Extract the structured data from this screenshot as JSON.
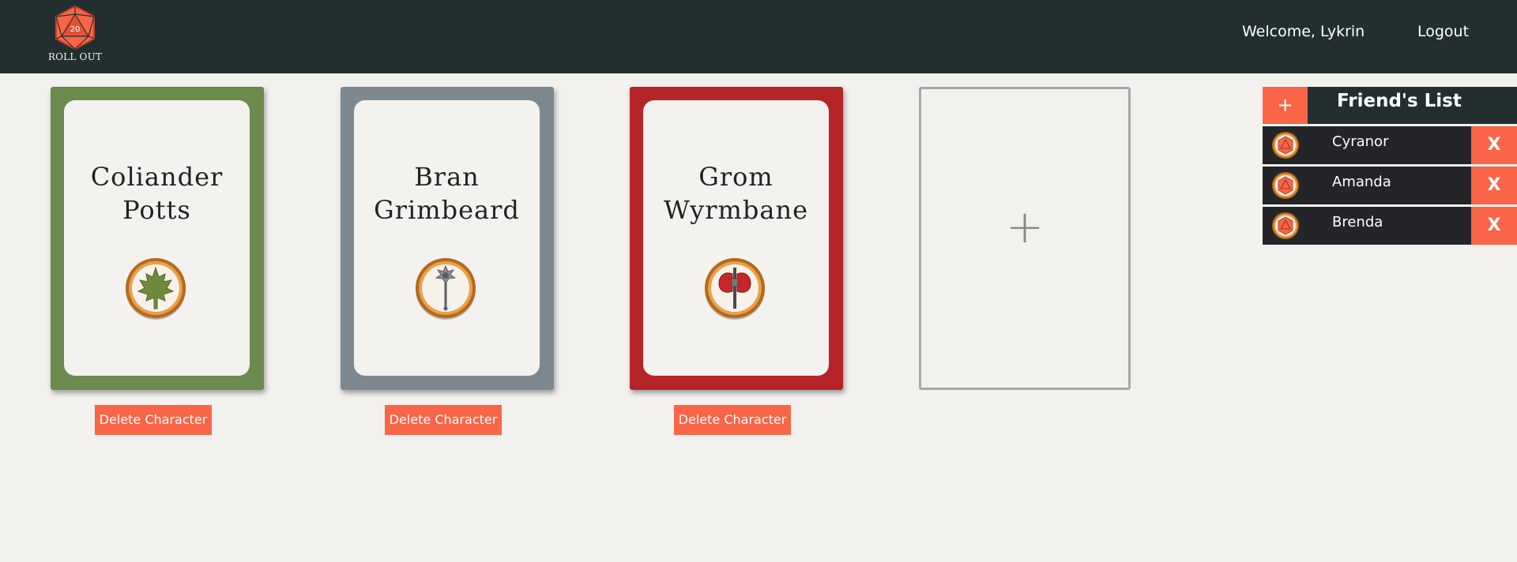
{
  "header": {
    "logo_text": "ROLL OUT",
    "logo_die_number": "20",
    "welcome": "Welcome, Lykrin",
    "logout": "Logout"
  },
  "characters": [
    {
      "name_line1": "Coliander",
      "name_line2": "Potts",
      "color": "#6a8a4e",
      "badge": "maple-leaf-icon",
      "delete_label": "Delete Character"
    },
    {
      "name_line1": "Bran",
      "name_line2": "Grimbeard",
      "color": "#7d8991",
      "badge": "mace-icon",
      "delete_label": "Delete Character"
    },
    {
      "name_line1": "Grom",
      "name_line2": "Wyrmbane",
      "color": "#b52427",
      "badge": "battle-axe-icon",
      "delete_label": "Delete Character"
    }
  ],
  "add_card": {
    "symbol": "+"
  },
  "friends": {
    "add_symbol": "+",
    "title": "Friend's List",
    "remove_symbol": "X",
    "items": [
      {
        "name": "Cyranor"
      },
      {
        "name": "Amanda"
      },
      {
        "name": "Brenda"
      }
    ]
  },
  "colors": {
    "header_bg": "#232e2f",
    "accent": "#fa6548",
    "page_bg": "#f3f1ee"
  }
}
